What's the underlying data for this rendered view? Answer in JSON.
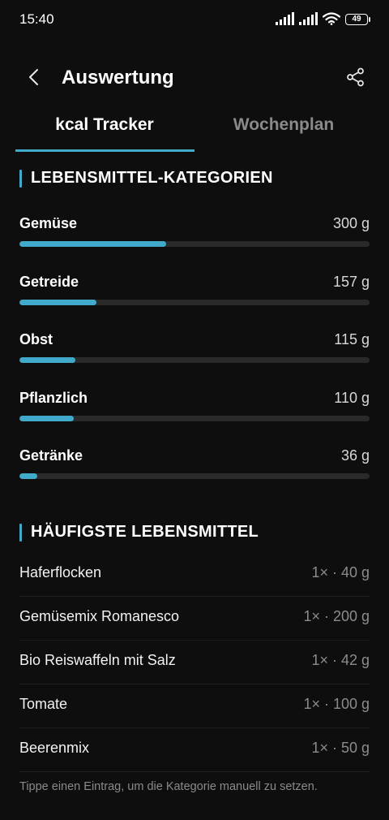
{
  "status_bar": {
    "time": "15:40",
    "battery": "49"
  },
  "header": {
    "title": "Auswertung"
  },
  "tabs": [
    {
      "label": "kcal Tracker",
      "active": true
    },
    {
      "label": "Wochenplan",
      "active": false
    }
  ],
  "categories": {
    "title": "LEBENSMITTEL-KATEGORIEN",
    "items": [
      {
        "name": "Gemüse",
        "amount": "300 g",
        "fill": 0.42
      },
      {
        "name": "Getreide",
        "amount": "157 g",
        "fill": 0.22
      },
      {
        "name": "Obst",
        "amount": "115 g",
        "fill": 0.16
      },
      {
        "name": "Pflanzlich",
        "amount": "110 g",
        "fill": 0.155
      },
      {
        "name": "Getränke",
        "amount": "36 g",
        "fill": 0.05
      }
    ]
  },
  "frequent": {
    "title": "HÄUFIGSTE LEBENSMITTEL",
    "items": [
      {
        "name": "Haferflocken",
        "qty": "1× · 40 g"
      },
      {
        "name": "Gemüsemix Romanesco",
        "qty": "1× · 200 g"
      },
      {
        "name": "Bio Reiswaffeln mit Salz",
        "qty": "1× · 42 g"
      },
      {
        "name": "Tomate",
        "qty": "1× · 100 g"
      },
      {
        "name": "Beerenmix",
        "qty": "1× · 50 g"
      }
    ]
  },
  "hint": "Tippe einen Eintrag, um die Kategorie manuell zu setzen.",
  "colors": {
    "accent": "#41a9c9",
    "background": "#0e0e0e",
    "track": "#2a2a2a"
  },
  "icons": {
    "back": "chevron-left-icon",
    "share": "share-icon"
  }
}
